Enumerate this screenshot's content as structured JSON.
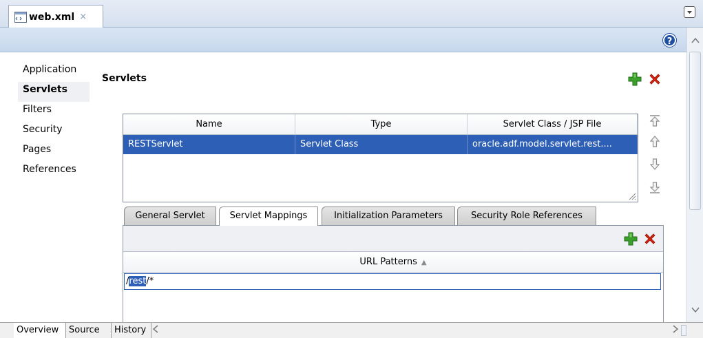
{
  "editor": {
    "file_tab": "web.xml",
    "close_glyph": "×",
    "help_glyph": "?"
  },
  "nav": {
    "items": [
      {
        "label": "Application",
        "active": false
      },
      {
        "label": "Servlets",
        "active": true
      },
      {
        "label": "Filters",
        "active": false
      },
      {
        "label": "Security",
        "active": false
      },
      {
        "label": "Pages",
        "active": false
      },
      {
        "label": "References",
        "active": false
      }
    ]
  },
  "section": {
    "title": "Servlets"
  },
  "servlets_table": {
    "columns": [
      "Name",
      "Type",
      "Servlet Class / JSP File"
    ],
    "rows": [
      {
        "name": "RESTServlet",
        "type": "Servlet Class",
        "class": "oracle.adf.model.servlet.rest...."
      }
    ]
  },
  "inner_tabs": [
    {
      "label": "General Servlet",
      "active": false
    },
    {
      "label": "Servlet Mappings",
      "active": true
    },
    {
      "label": "Initialization Parameters",
      "active": false
    },
    {
      "label": "Security Role References",
      "active": false
    }
  ],
  "mappings": {
    "header": "URL Patterns",
    "sort_glyph": "▲",
    "value_prefix": "/",
    "value_selected": "rest",
    "value_suffix": "/*"
  },
  "bottom_tabs": [
    {
      "label": "Overview",
      "active": true
    },
    {
      "label": "Source",
      "active": false
    },
    {
      "label": "History",
      "active": false
    }
  ],
  "icons": {
    "add": "add-icon",
    "delete": "delete-icon",
    "move_top": "move-top-icon",
    "move_up": "move-up-icon",
    "move_down": "move-down-icon",
    "move_bottom": "move-bottom-icon"
  },
  "colors": {
    "selection": "#2d5fb6",
    "add_green": "#3ca02c",
    "delete_red": "#d9230f"
  }
}
